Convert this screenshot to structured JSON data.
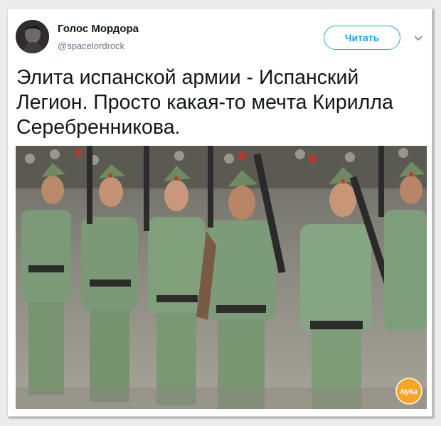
{
  "tweet": {
    "display_name": "Голос Мордора",
    "handle": "@spacelordrock",
    "follow_label": "Читать",
    "text_lines": [
      "Элита испанской армии - Испанский",
      "Легион. Просто какая-то мечта Кирилла",
      "Серебренникова."
    ]
  },
  "watermark": {
    "label": "Nyka"
  },
  "colors": {
    "accent": "#1da1f2",
    "text": "#14171a",
    "secondary_text": "#657786",
    "uniform": "#7d9a78"
  },
  "icons": {
    "menu": "chevron-down-icon",
    "avatar": "avatar-photo"
  }
}
